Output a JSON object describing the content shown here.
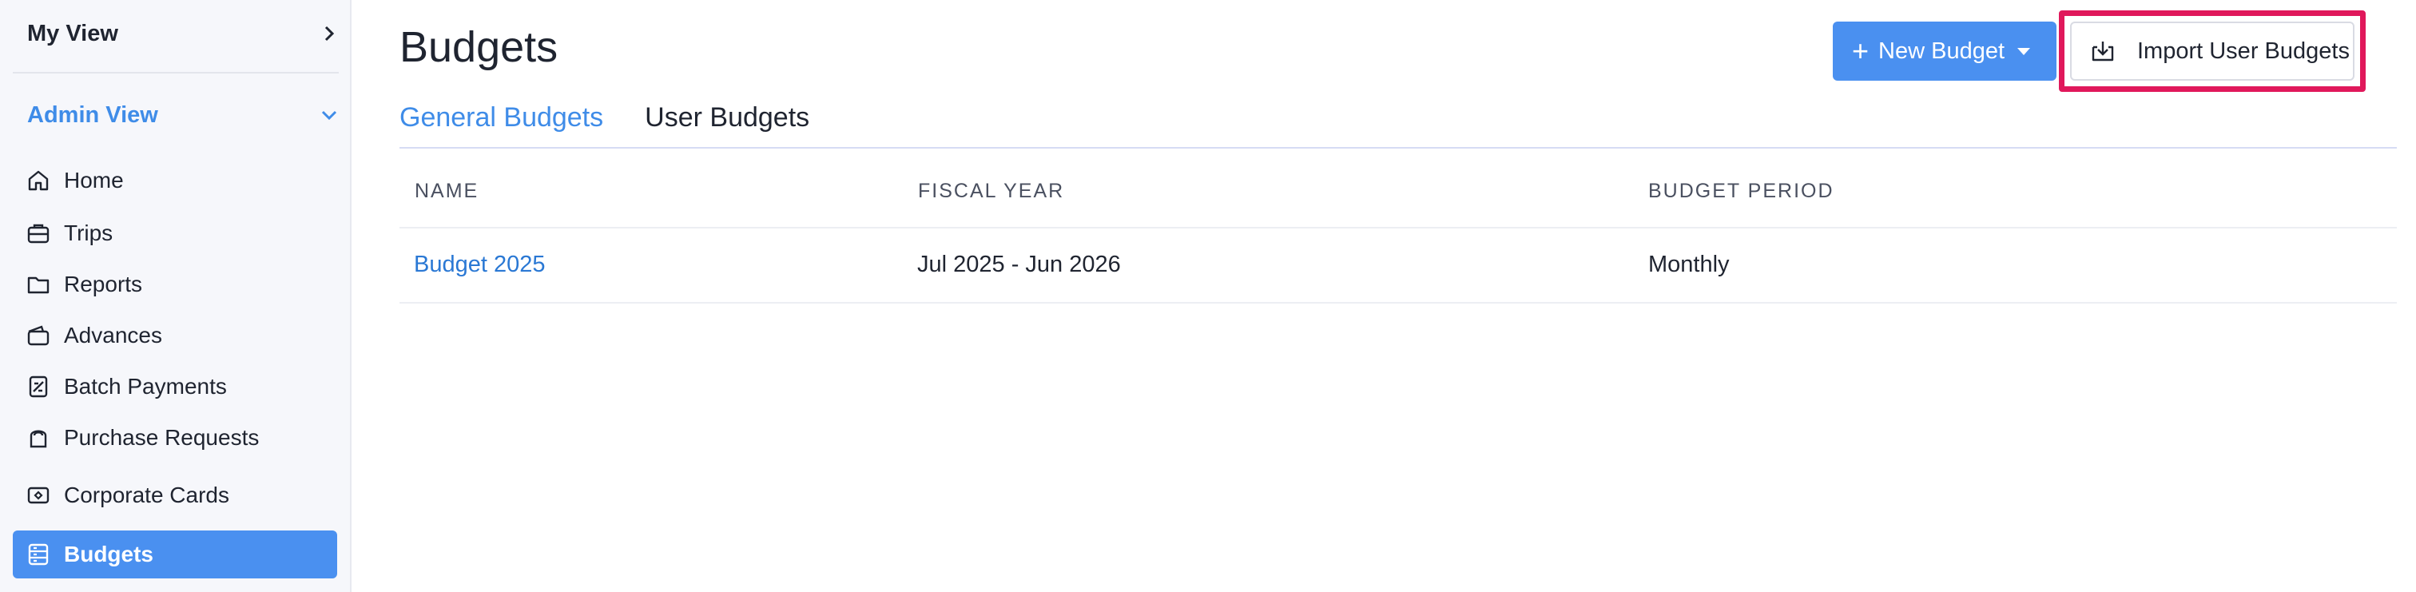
{
  "sidebar": {
    "my_view": "My View",
    "admin_view": "Admin View",
    "items": [
      {
        "label": "Home",
        "icon": "home-icon"
      },
      {
        "label": "Trips",
        "icon": "briefcase-icon"
      },
      {
        "label": "Reports",
        "icon": "folder-icon"
      },
      {
        "label": "Advances",
        "icon": "wallet-icon"
      },
      {
        "label": "Batch Payments",
        "icon": "batch-payments-icon"
      },
      {
        "label": "Purchase Requests",
        "icon": "shopping-bag-icon"
      },
      {
        "label": "Corporate Cards",
        "icon": "card-icon"
      },
      {
        "label": "Budgets",
        "icon": "budget-icon",
        "active": true
      }
    ]
  },
  "header": {
    "title": "Budgets",
    "new_budget": "New Budget",
    "import_user_budgets": "Import User Budgets"
  },
  "tabs": [
    {
      "label": "General Budgets",
      "active": true
    },
    {
      "label": "User Budgets",
      "active": false
    }
  ],
  "table": {
    "columns": [
      "NAME",
      "FISCAL YEAR",
      "BUDGET PERIOD"
    ],
    "rows": [
      [
        "Budget 2025",
        "Jul 2025 - Jun 2026",
        "Monthly"
      ]
    ]
  },
  "colors": {
    "accent": "#4a90f0",
    "highlight": "#e0185b",
    "link": "#2a78d4"
  }
}
